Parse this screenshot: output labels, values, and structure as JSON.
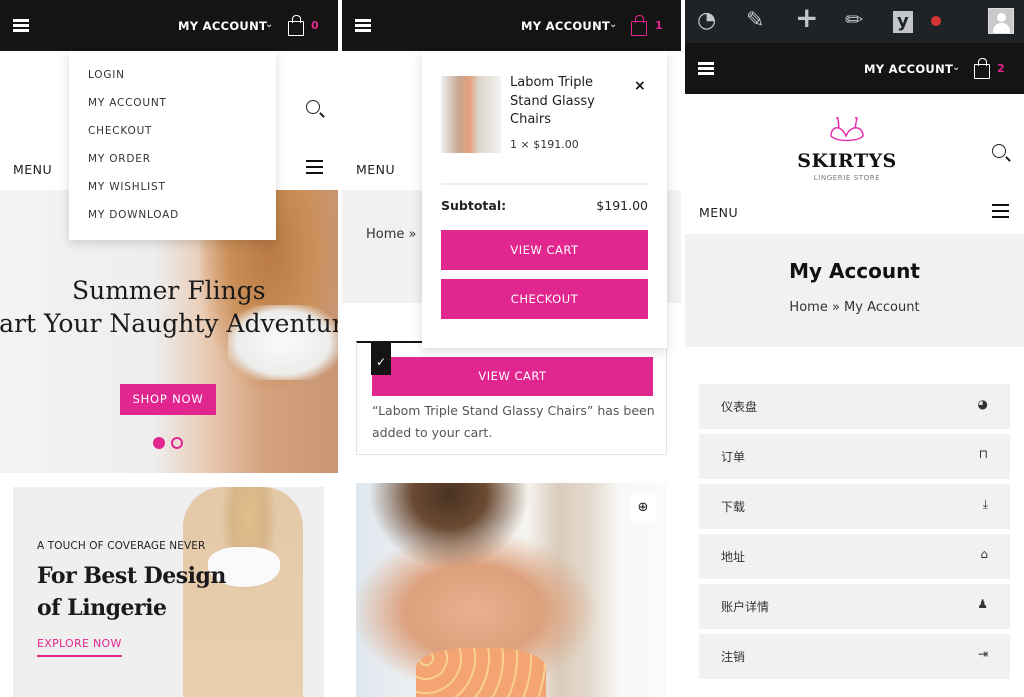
{
  "colors": {
    "accent": "#e2268f",
    "topbar": "#141414",
    "wp_adminbar": "#1f2227",
    "band": "#f1f1f1"
  },
  "panel1": {
    "topbar": {
      "menu_icon": "hamburger-icon",
      "account_label": "MY ACCOUNT",
      "cart_count": "0"
    },
    "account_dropdown": [
      "LOGIN",
      "MY ACCOUNT",
      "CHECKOUT",
      "MY ORDER",
      "MY WISHLIST",
      "MY DOWNLOAD"
    ],
    "menu_label": "MENU",
    "hero": {
      "line1": "Summer Flings",
      "line2": "Start Your Naughty Adventure",
      "button": "SHOP NOW",
      "slides": 2,
      "active_slide": 1
    },
    "promo": {
      "eyebrow": "A TOUCH OF COVERAGE NEVER",
      "heading_line1": "For Best Design",
      "heading_line2": "of Lingerie",
      "link": "EXPLORE NOW"
    }
  },
  "panel2": {
    "topbar": {
      "account_label": "MY ACCOUNT",
      "cart_count": "1"
    },
    "menu_label": "MENU",
    "breadcrumb": "Home »",
    "mini_cart": {
      "item_name": "Labom Triple Stand Glassy Chairs",
      "item_qty_price": "1 ×  $191.00",
      "remove": "×",
      "subtotal_label": "Subtotal:",
      "subtotal_value": "$191.00",
      "view_cart": "VIEW CART",
      "checkout": "CHECKOUT"
    },
    "notice": {
      "check": "✓",
      "button": "VIEW CART",
      "message": "“Labom Triple Stand Glassy Chairs” has been added to your cart."
    },
    "zoom_icon": "⊕"
  },
  "panel3": {
    "admin_bar": {
      "icons": [
        "dashboard-icon",
        "customize-icon",
        "new-icon",
        "edit-icon",
        "yoast-icon",
        "notification-dot",
        "user-avatar"
      ]
    },
    "topbar": {
      "account_label": "MY ACCOUNT",
      "cart_count": "2"
    },
    "logo": {
      "name": "SKIRTYS",
      "tagline": "LINGERIE STORE"
    },
    "menu_label": "MENU",
    "page_title": "My Account",
    "breadcrumb": "Home » My Account",
    "account_nav": [
      {
        "label": "仪表盘",
        "icon": "dashboard-icon"
      },
      {
        "label": "订单",
        "icon": "basket-icon"
      },
      {
        "label": "下载",
        "icon": "download-icon"
      },
      {
        "label": "地址",
        "icon": "home-icon"
      },
      {
        "label": "账户详情",
        "icon": "user-icon"
      },
      {
        "label": "注销",
        "icon": "logout-icon"
      }
    ]
  }
}
